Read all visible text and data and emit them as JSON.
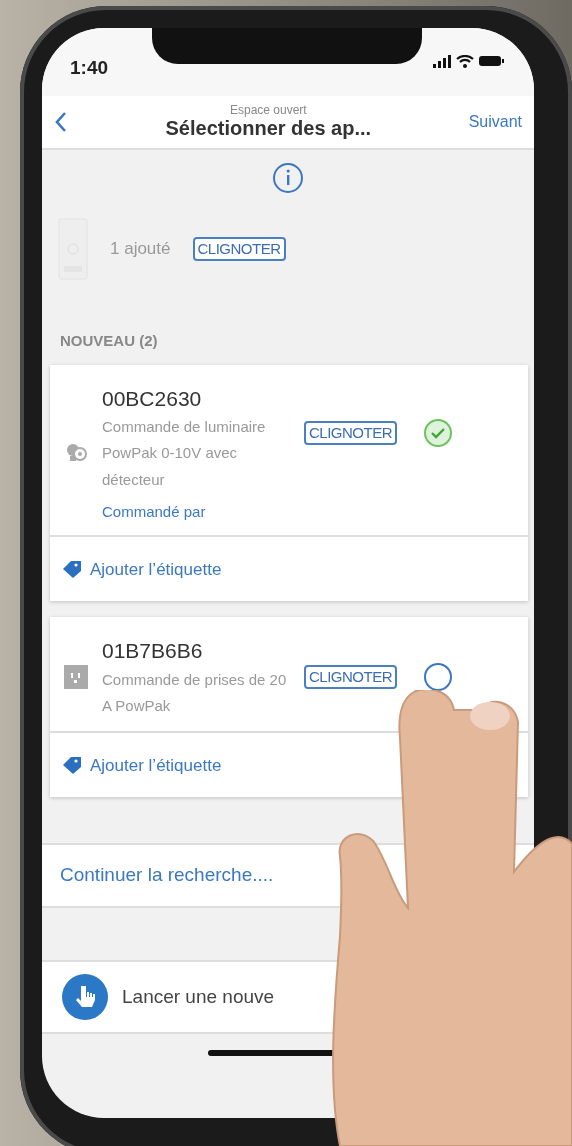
{
  "status_bar": {
    "time": "1:40"
  },
  "header": {
    "subtitle": "Espace ouvert",
    "title": "Sélectionner des ap...",
    "next": "Suivant"
  },
  "added": {
    "count_label": "1 ajouté",
    "flash": "CLIGNOTER"
  },
  "section_title": "NOUVEAU (2)",
  "devices": [
    {
      "kind": "luminaire",
      "serial": "00BC2630",
      "description": "Commande de luminaire PowPak 0-10V avec détecteur",
      "controlled_by": "Commandé par",
      "flash": "CLIGNOTER",
      "checked": true,
      "tag_action": "Ajouter l’étiquette"
    },
    {
      "kind": "receptacle",
      "serial": "01B7B6B6",
      "description": "Commande de prises de 20 A PowPak",
      "flash": "CLIGNOTER",
      "checked": false,
      "tag_action": "Ajouter l’étiquette"
    }
  ],
  "continue_search": "Continuer la recherche....",
  "new_search": "Lancer une nouve"
}
